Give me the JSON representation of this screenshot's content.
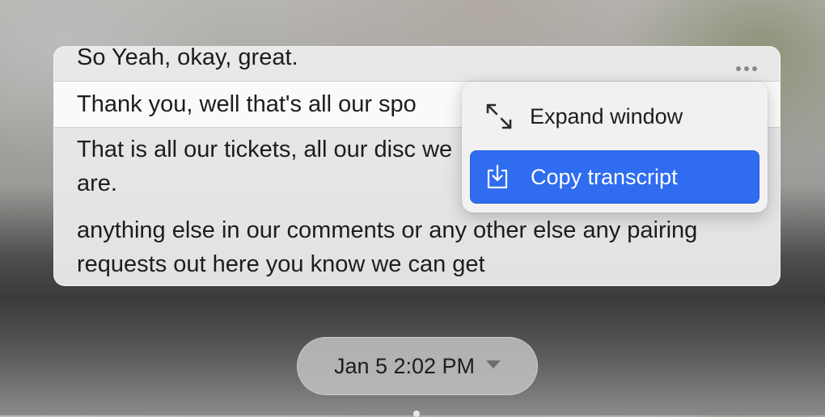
{
  "transcript": {
    "lines": [
      "So Yeah, okay, great.",
      "Thank you, well that's all our spo",
      "That is all our tickets, all our disc we are.",
      "anything else in our comments or any other else any pairing requests out here you know we can get"
    ],
    "highlighted_index": 1
  },
  "menu": {
    "items": [
      {
        "label": "Expand window",
        "icon": "expand-arrows-icon"
      },
      {
        "label": "Copy transcript",
        "icon": "download-tray-icon",
        "selected": true
      }
    ],
    "accent": "#2f6cf0"
  },
  "date_selector": {
    "label": "Jan 5 2:02 PM",
    "icon": "caret-down-icon"
  }
}
